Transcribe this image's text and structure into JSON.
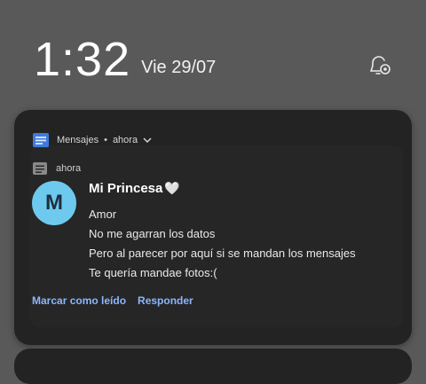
{
  "lockscreen": {
    "time": "1:32",
    "date": "Vie 29/07"
  },
  "icons": {
    "settings": "notification-settings-icon",
    "app": "messages-app-icon",
    "sender": "conversation-icon",
    "expand": "chevron-down-icon"
  },
  "notification": {
    "app_name": "Mensajes",
    "separator": "•",
    "time": "ahora",
    "sub_time": "ahora",
    "avatar_letter": "M",
    "title": "Mi Princesa",
    "title_emoji": "🤍",
    "messages": [
      "Amor",
      "No me agarran los datos",
      "Pero al parecer por aquí si se mandan los mensajes",
      "Te quería mandae fotos:("
    ],
    "actions": {
      "mark_read": "Marcar como leído",
      "reply": "Responder"
    }
  },
  "colors": {
    "background": "#595959",
    "card": "#232323",
    "avatar": "#6ec9ee",
    "action": "#8cb6ff"
  }
}
